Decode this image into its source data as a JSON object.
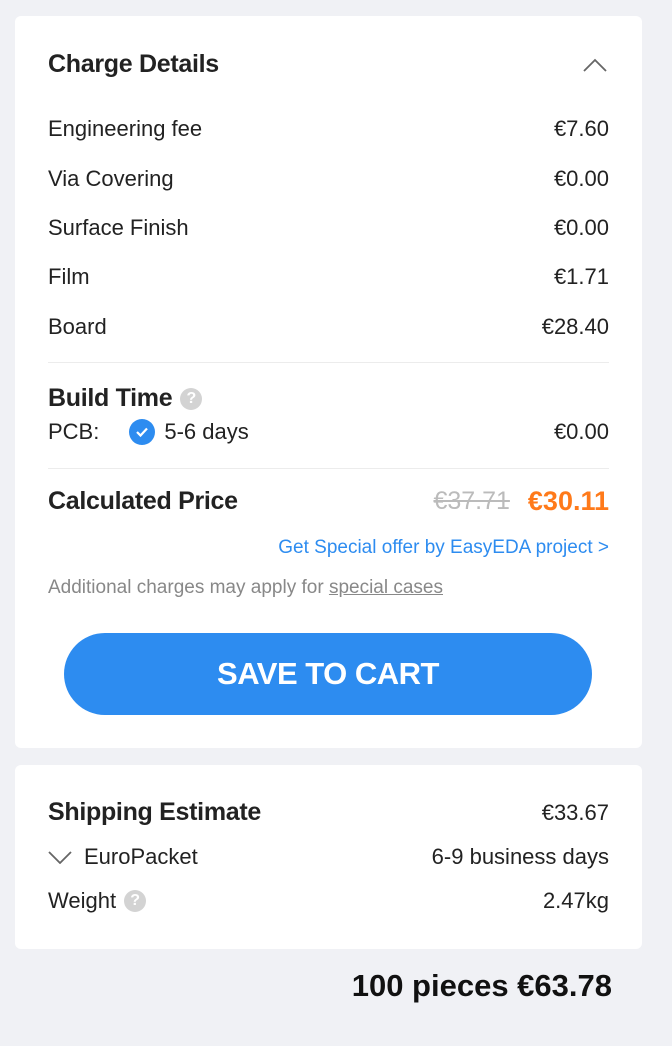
{
  "charge_details": {
    "title": "Charge Details",
    "items": [
      {
        "label": "Engineering fee",
        "value": "€7.60"
      },
      {
        "label": "Via Covering",
        "value": "€0.00"
      },
      {
        "label": "Surface Finish",
        "value": "€0.00"
      },
      {
        "label": "Film",
        "value": "€1.71"
      },
      {
        "label": "Board",
        "value": "€28.40"
      }
    ]
  },
  "build_time": {
    "title": "Build Time",
    "pcb_label": "PCB:",
    "option": "5-6 days",
    "value": "€0.00"
  },
  "price": {
    "title": "Calculated Price",
    "original": "€37.71",
    "final": "€30.11",
    "offer_link": "Get Special offer by EasyEDA project >",
    "note_prefix": "Additional charges may apply for ",
    "note_link": "special cases"
  },
  "save_button": "SAVE TO CART",
  "shipping": {
    "title": "Shipping Estimate",
    "cost": "€33.67",
    "method": "EuroPacket",
    "duration": "6-9 business days",
    "weight_label": "Weight",
    "weight_value": "2.47kg"
  },
  "total": "100 pieces €63.78",
  "colors": {
    "accent": "#2d8cf0",
    "price": "#ff7a1a",
    "background": "#f0f1f5"
  }
}
